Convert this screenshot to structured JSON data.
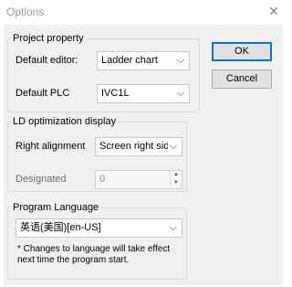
{
  "window": {
    "title": "Options",
    "close_glyph": "✕"
  },
  "project_property": {
    "title": "Project property",
    "default_editor": {
      "label": "Default editor:",
      "value": "Ladder chart"
    },
    "default_plc": {
      "label": "Default PLC",
      "value": "IVC1L"
    }
  },
  "ld_display": {
    "title": "LD optimization display",
    "right_alignment": {
      "label": "Right alignment",
      "value": "Screen right side"
    },
    "designated": {
      "label": "Designated",
      "value": "0"
    }
  },
  "program_language": {
    "title": "Program Language",
    "value": "英语(美国)[en-US]",
    "note_line1": "* Changes to language will take effect",
    "note_line2": "next time the program start."
  },
  "buttons": {
    "ok": "OK",
    "cancel": "Cancel"
  },
  "icons": {
    "chevron": "⌵",
    "spin_up": "▲",
    "spin_down": "▼"
  }
}
